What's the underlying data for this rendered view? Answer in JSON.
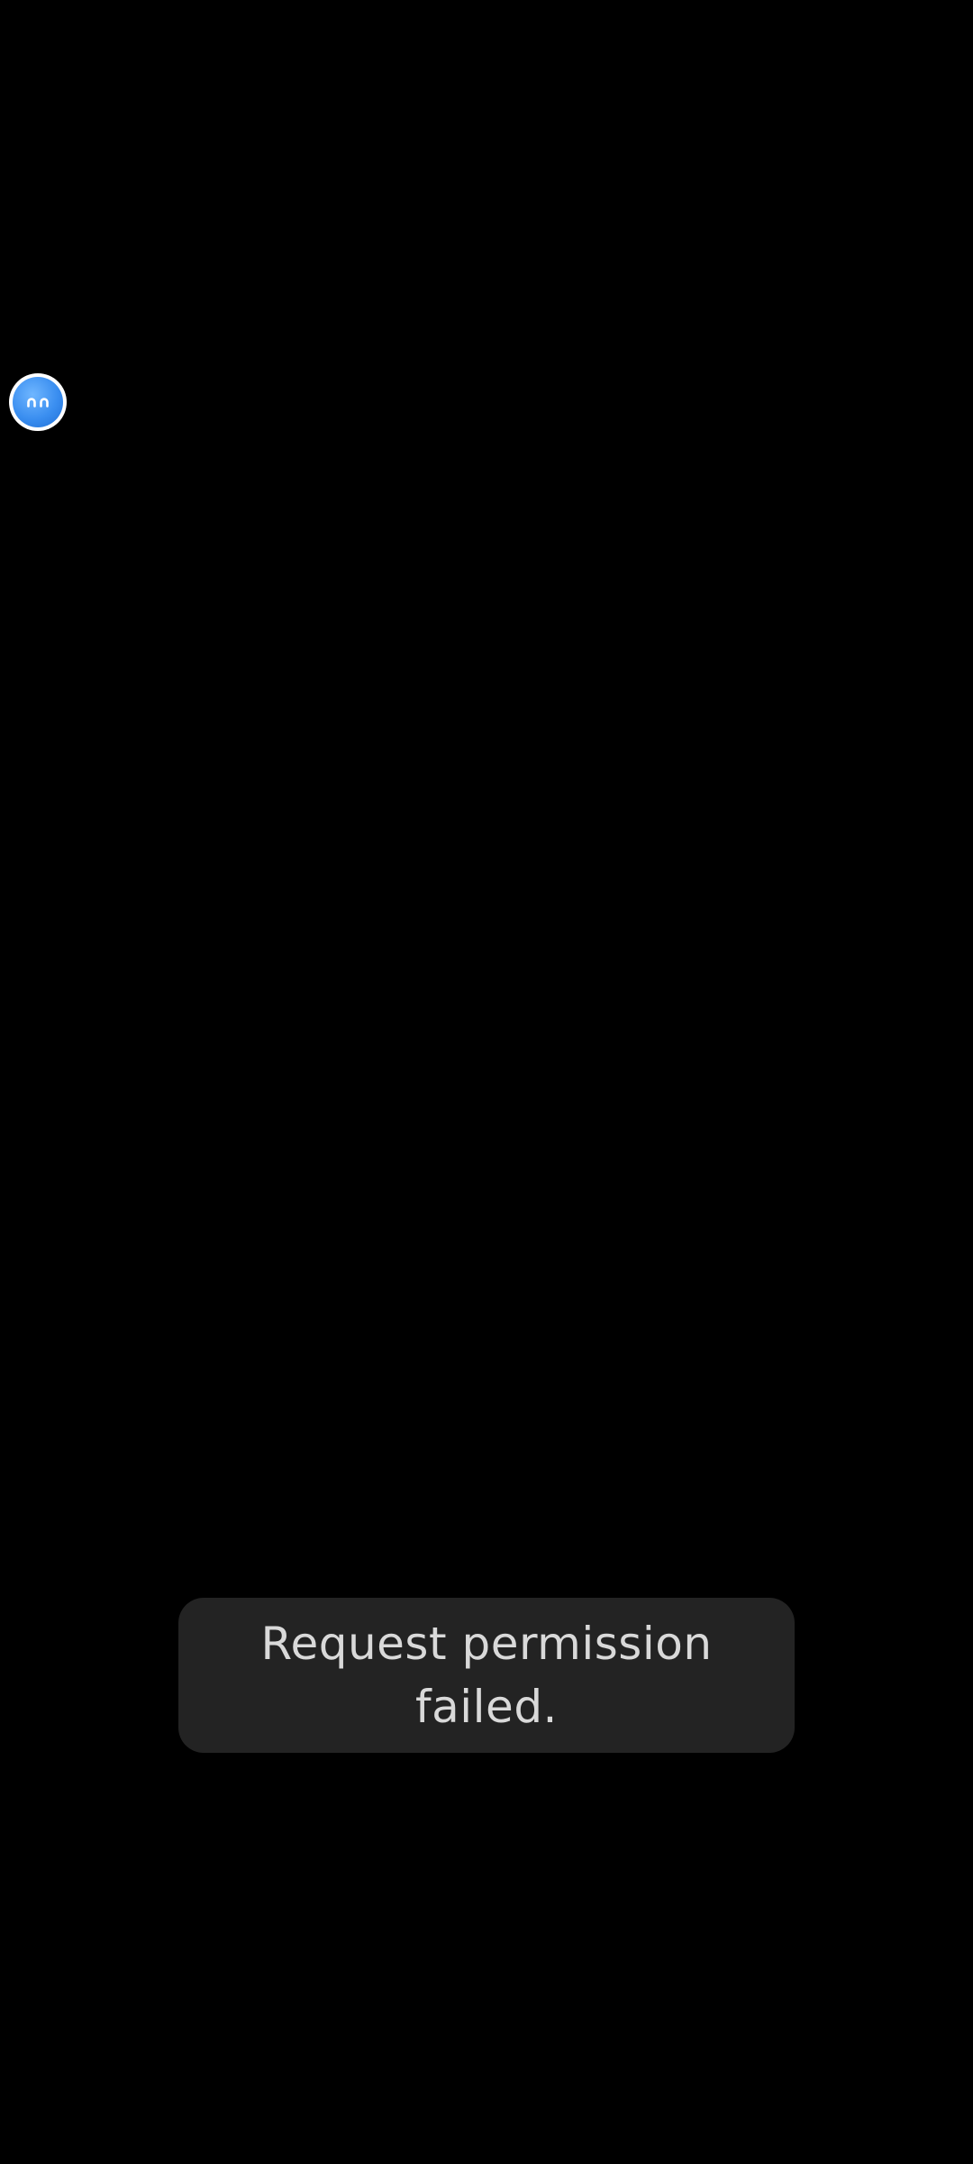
{
  "floating_bubble": {
    "icon": "assistant-face-icon",
    "accent_color": "#3a8ef0"
  },
  "toast": {
    "message": "Request permission failed."
  },
  "colors": {
    "background": "#000000",
    "toast_background": "#232323",
    "toast_text": "#d9d9d9"
  }
}
